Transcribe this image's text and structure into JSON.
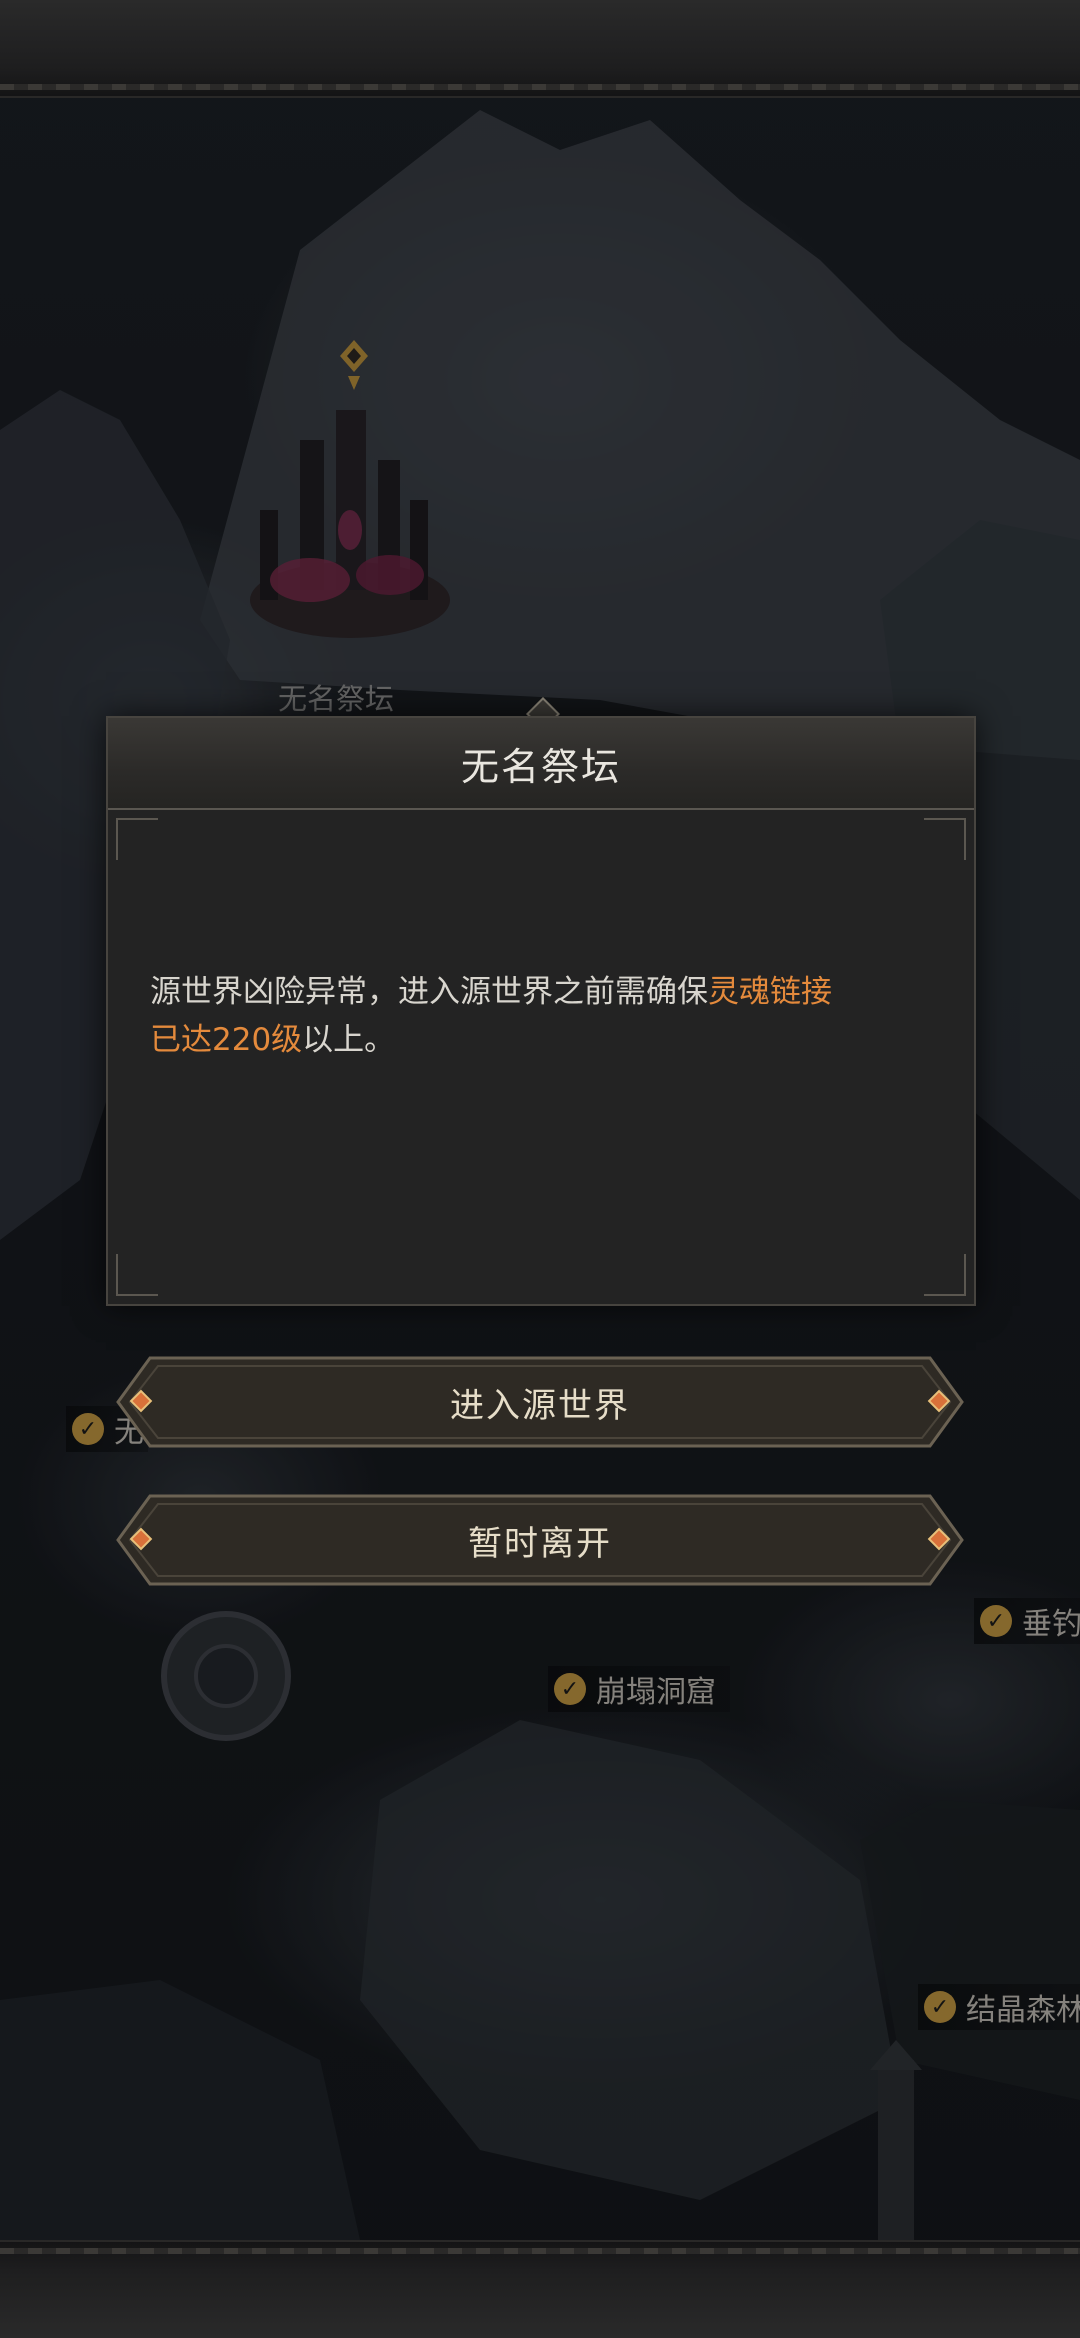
{
  "map": {
    "altar_label": "无名祭坛",
    "locations": [
      {
        "name": "崩塌洞窟",
        "checked": true
      },
      {
        "name": "结晶森林",
        "checked": true
      },
      {
        "name": "垂钓",
        "checked": true
      },
      {
        "name": "无",
        "checked": true
      }
    ]
  },
  "dialog": {
    "title": "无名祭坛",
    "message_plain": "源世界凶险异常，进入源世界之前需确保",
    "message_highlight": "灵魂链接",
    "message_line2_highlight": "已达220级",
    "message_tail": "以上。",
    "highlight_color": "#e48a3c"
  },
  "buttons": {
    "enter": "进入源世界",
    "leave": "暂时离开"
  }
}
